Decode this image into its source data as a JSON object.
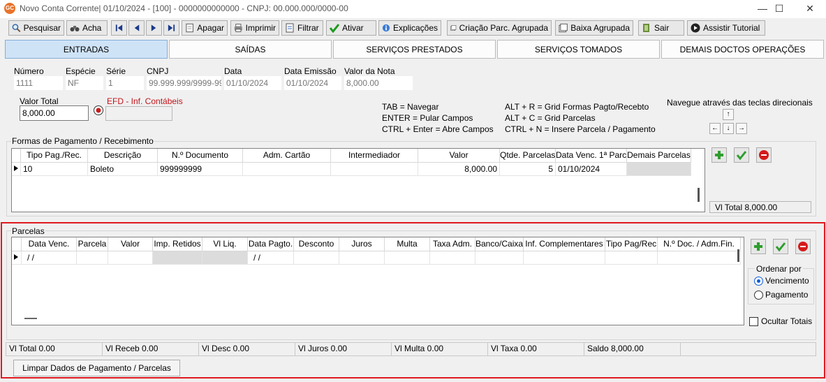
{
  "window": {
    "title": "Novo Conta Corrente|  01/10/2024 - [100] - 0000000000000 - CNPJ: 00.000.000/0000-00",
    "app_icon_text": "GC",
    "minimize": "—",
    "maximize": "☐",
    "close": "✕"
  },
  "toolbar": {
    "pesquisar": "Pesquisar",
    "acha": "Acha",
    "apagar": "Apagar",
    "imprimir": "Imprimir",
    "filtrar": "Filtrar",
    "ativar": "Ativar",
    "explicacoes": "Explicações",
    "criacao": "Criação Parc. Agrupada",
    "baixa": "Baixa Agrupada",
    "sair": "Sair",
    "assistir": "Assistir Tutorial"
  },
  "tabs": [
    "ENTRADAS",
    "SAÍDAS",
    "SERVIÇOS PRESTADOS",
    "SERVIÇOS TOMADOS",
    "DEMAIS DOCTOS OPERAÇÕES"
  ],
  "header_fields": {
    "numero_label": "Número",
    "numero": "1111",
    "especie_label": "Espécie",
    "especie": "NF",
    "serie_label": "Série",
    "serie": "1",
    "cnpj_label": "CNPJ",
    "cnpj": "99.999.999/9999-99",
    "data_label": "Data",
    "data": "01/10/2024",
    "emissao_label": "Data Emissão",
    "emissao": "01/10/2024",
    "valor_label": "Valor da Nota",
    "valor": "8,000.00"
  },
  "valor_total": {
    "label": "Valor Total",
    "value": "8,000.00"
  },
  "efd_label": "EFD - Inf. Contábeis",
  "shortcuts": {
    "col1": [
      "TAB = Navegar",
      "ENTER = Pular Campos",
      "CTRL + Enter = Abre Campos"
    ],
    "col2": [
      "ALT + R = Grid Formas Pagto/Recebto",
      "ALT + C = Grid Parcelas",
      "CTRL + N = Insere Parcela / Pagamento"
    ],
    "nav_title": "Navegue através das teclas direcionais",
    "arrows": {
      "up": "↑",
      "left": "←",
      "down": "↓",
      "right": "→"
    }
  },
  "formas": {
    "title": "Formas de Pagamento / Recebimento",
    "columns": [
      "Tipo Pag./Rec.",
      "Descrição",
      "N.º Documento",
      "Adm. Cartão",
      "Intermediador",
      "Valor",
      "Qtde. Parcelas",
      "Data Venc. 1ª Parc.",
      "Demais Parcelas"
    ],
    "row": {
      "tipo": "10",
      "descricao": "Boleto",
      "documento": "999999999",
      "adm": "",
      "intermediador": "",
      "valor": "8,000.00",
      "qtde": "5",
      "venc": "01/10/2024",
      "demais": ""
    },
    "vl_total": "Vl Total  8,000.00"
  },
  "parcelas": {
    "title": "Parcelas",
    "columns": [
      "Data Venc.",
      "Parcela",
      "Valor",
      "Imp. Retidos",
      "Vl Liq.",
      "Data Pagto.",
      "Desconto",
      "Juros",
      "Multa",
      "Taxa Adm.",
      "Banco/Caixa",
      "Inf. Complementares",
      "Tipo Pag/Rec",
      "N.º Doc. / Adm.Fin."
    ],
    "row": {
      "data_venc": " / /",
      "data_pagto": " / /"
    },
    "ordenar_por": "Ordenar por",
    "vencimento": "Vencimento",
    "pagamento": "Pagamento",
    "ocultar_totais": "Ocultar Totais"
  },
  "status": {
    "vl_total": "Vl Total  0.00",
    "vl_receb": "Vl Receb  0.00",
    "vl_desc": "Vl Desc  0.00",
    "vl_juros": "Vl Juros  0.00",
    "vl_multa": "Vl Multa  0.00",
    "vl_taxa": "Vl Taxa  0.00",
    "saldo": "Saldo  8,000.00"
  },
  "limpar_button": "Limpar Dados de Pagamento / Parcelas",
  "colors": {
    "highlight_border": "#e0191e",
    "active_tab": "#cfe3f7",
    "plus_green": "#2e9e2e",
    "minus_red": "#d51a1a"
  }
}
